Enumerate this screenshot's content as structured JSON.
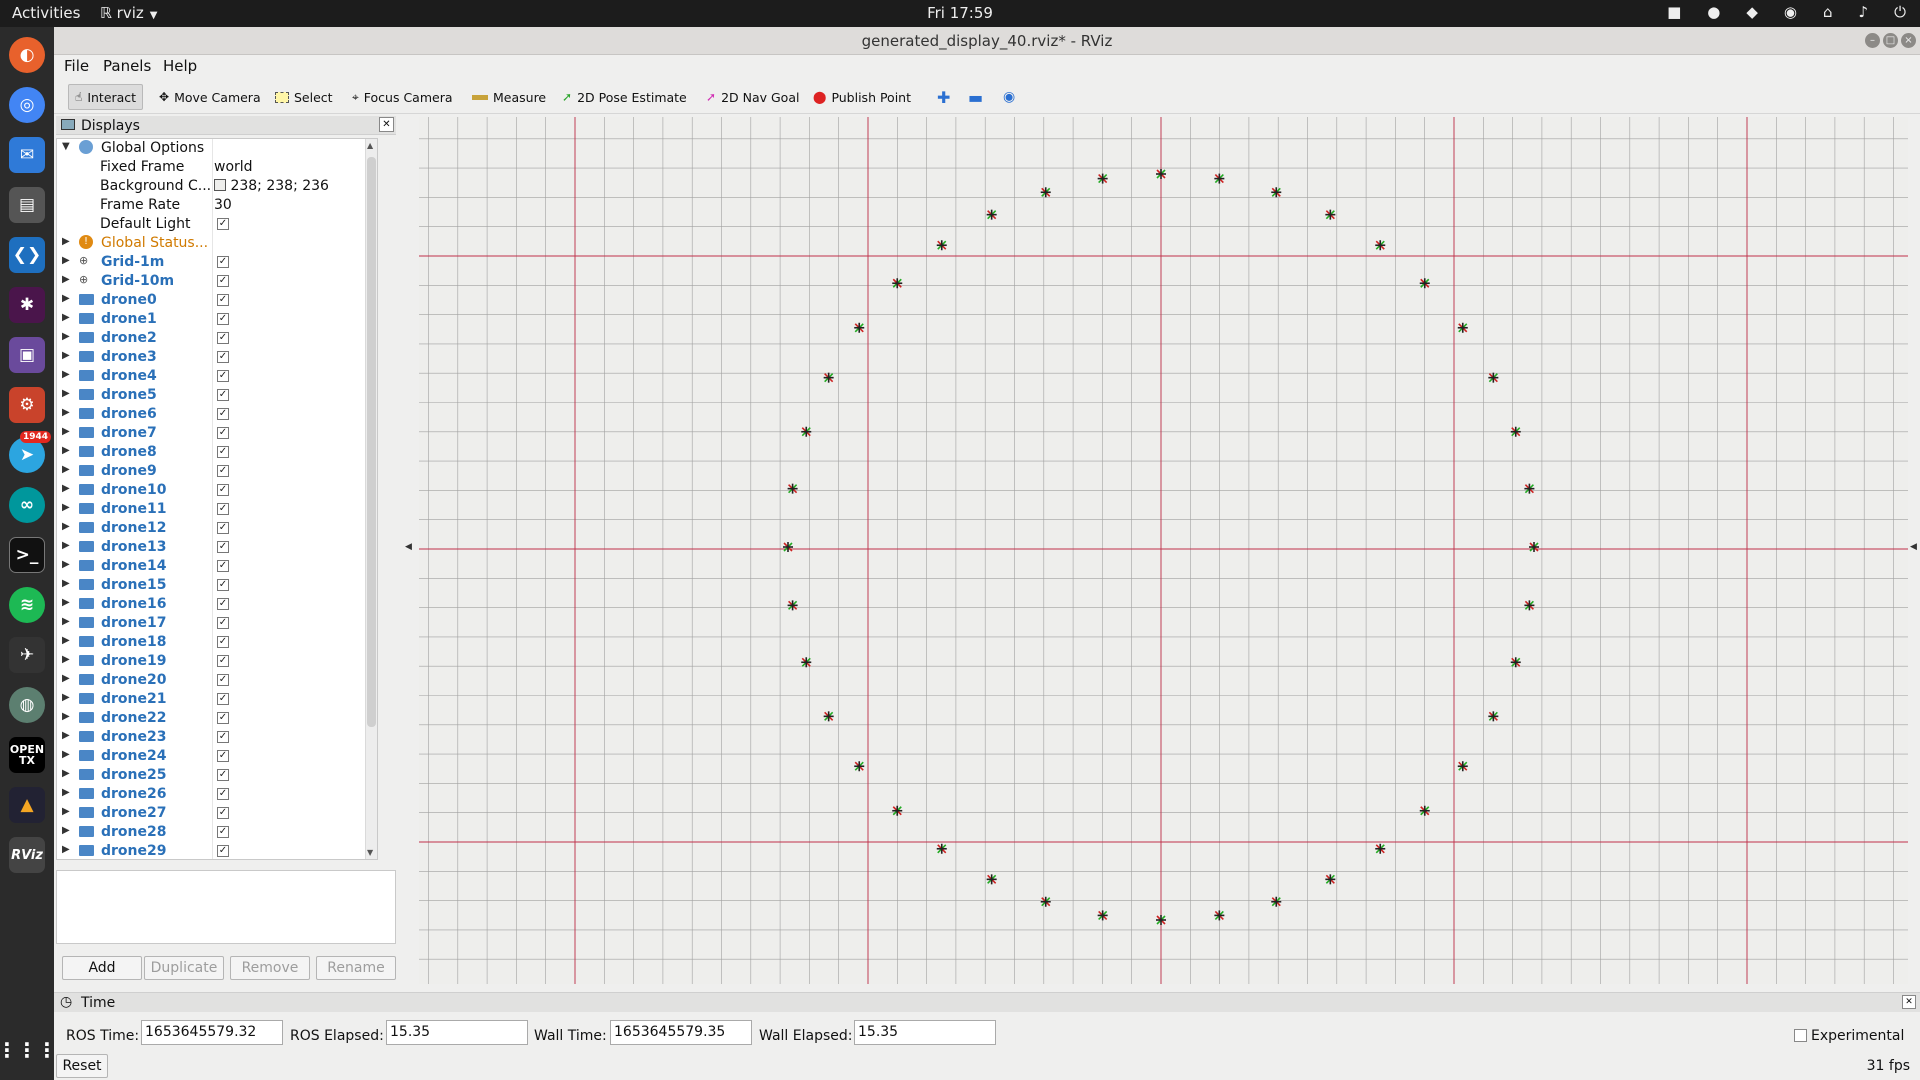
{
  "topbar": {
    "activities": "Activities",
    "app_name": "rviz",
    "clock": "Fri 17:59"
  },
  "window": {
    "title": "generated_display_40.rviz* - RViz"
  },
  "menu": [
    "File",
    "Panels",
    "Help"
  ],
  "toolbar": {
    "interact": "Interact",
    "move_camera": "Move Camera",
    "select": "Select",
    "focus_camera": "Focus Camera",
    "measure": "Measure",
    "pose_estimate": "2D Pose Estimate",
    "nav_goal": "2D Nav Goal",
    "publish_point": "Publish Point"
  },
  "displays": {
    "title": "Displays",
    "global_options": "Global Options",
    "fixed_frame_label": "Fixed Frame",
    "fixed_frame_value": "world",
    "background_label": "Background C...",
    "background_value": "238; 238; 236",
    "frame_rate_label": "Frame Rate",
    "frame_rate_value": "30",
    "default_light_label": "Default Light",
    "global_status": "Global Status...",
    "grids": [
      "Grid-1m",
      "Grid-10m"
    ],
    "drones": [
      "drone0",
      "drone1",
      "drone2",
      "drone3",
      "drone4",
      "drone5",
      "drone6",
      "drone7",
      "drone8",
      "drone9",
      "drone10",
      "drone11",
      "drone12",
      "drone13",
      "drone14",
      "drone15",
      "drone16",
      "drone17",
      "drone18",
      "drone19",
      "drone20",
      "drone21",
      "drone22",
      "drone23",
      "drone24",
      "drone25",
      "drone26",
      "drone27",
      "drone28",
      "drone29"
    ],
    "buttons": {
      "add": "Add",
      "duplicate": "Duplicate",
      "remove": "Remove",
      "rename": "Rename"
    }
  },
  "time": {
    "title": "Time",
    "ros_time_label": "ROS Time:",
    "ros_time": "1653645579.32",
    "ros_elapsed_label": "ROS Elapsed:",
    "ros_elapsed": "15.35",
    "wall_time_label": "Wall Time:",
    "wall_time": "1653645579.35",
    "wall_elapsed_label": "Wall Elapsed:",
    "wall_elapsed": "15.35",
    "experimental": "Experimental",
    "reset": "Reset",
    "fps": "31 fps"
  },
  "dock": {
    "telegram_badge": "1944",
    "opentx_label": "OPEN TX",
    "rviz_label": "RViz"
  },
  "colors": {
    "grid": "#a0a0a0",
    "major_grid": "#c0304a",
    "background": "#eeeeec",
    "link": "#2a70b8"
  },
  "scene": {
    "drone_count": 40
  }
}
